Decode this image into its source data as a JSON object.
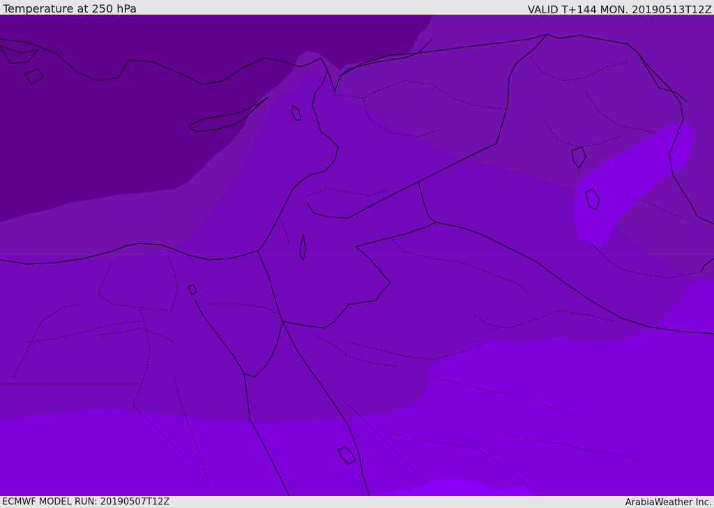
{
  "header": {
    "title": "Temperature at 250 hPa",
    "valid": "VALID T+144 MON. 20190513T12Z"
  },
  "footer": {
    "model_run": "ECMWF MODEL RUN: 20190507T12Z",
    "credit": "ArabiaWeather Inc."
  },
  "colors": {
    "coldest_band": "#61008e",
    "cold_band": "#7311af",
    "mid_band": "#7408bb",
    "warm_band": "#8000da",
    "warmest_band": "#8a00f6",
    "isolated_warm_patch": "#8300e3",
    "border_line": "#000000"
  }
}
